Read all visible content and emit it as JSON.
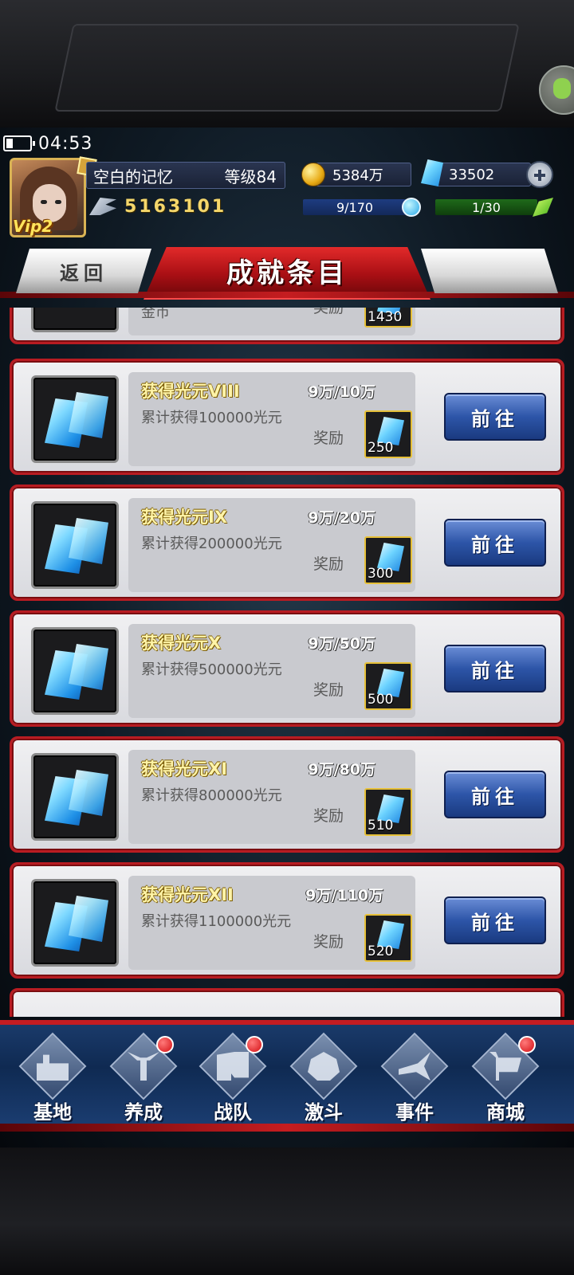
{
  "status": {
    "time": "04:53"
  },
  "player": {
    "name": "空白的记忆",
    "level": "等级84",
    "power": "5163101",
    "vip": "Vip2"
  },
  "resources": {
    "gold": "5384万",
    "gems": "33502",
    "energy": "9/170",
    "stamina": "1/30"
  },
  "header": {
    "title": "成就条目",
    "back_label": "返回"
  },
  "partial_top": {
    "desc": "金币",
    "reward_label": "奖励",
    "reward_qty": "1430"
  },
  "achievements": [
    {
      "name": "获得光元VIII",
      "progress": "9万/10万",
      "desc": "累计获得100000光元",
      "reward_label": "奖励",
      "reward_qty": "250",
      "action": "前往"
    },
    {
      "name": "获得光元IX",
      "progress": "9万/20万",
      "desc": "累计获得200000光元",
      "reward_label": "奖励",
      "reward_qty": "300",
      "action": "前往"
    },
    {
      "name": "获得光元X",
      "progress": "9万/50万",
      "desc": "累计获得500000光元",
      "reward_label": "奖励",
      "reward_qty": "500",
      "action": "前往"
    },
    {
      "name": "获得光元XI",
      "progress": "9万/80万",
      "desc": "累计获得800000光元",
      "reward_label": "奖励",
      "reward_qty": "510",
      "action": "前往"
    },
    {
      "name": "获得光元XII",
      "progress": "9万/110万",
      "desc": "累计获得1100000光元",
      "reward_label": "奖励",
      "reward_qty": "520",
      "action": "前往"
    }
  ],
  "nav": [
    {
      "label": "基地",
      "badge": false
    },
    {
      "label": "养成",
      "badge": true
    },
    {
      "label": "战队",
      "badge": true
    },
    {
      "label": "激斗",
      "badge": false
    },
    {
      "label": "事件",
      "badge": false
    },
    {
      "label": "商城",
      "badge": true
    }
  ],
  "colors": {
    "accent_red": "#c41c22",
    "button_blue": "#2d55a8",
    "gold_text": "#f5d76b"
  }
}
